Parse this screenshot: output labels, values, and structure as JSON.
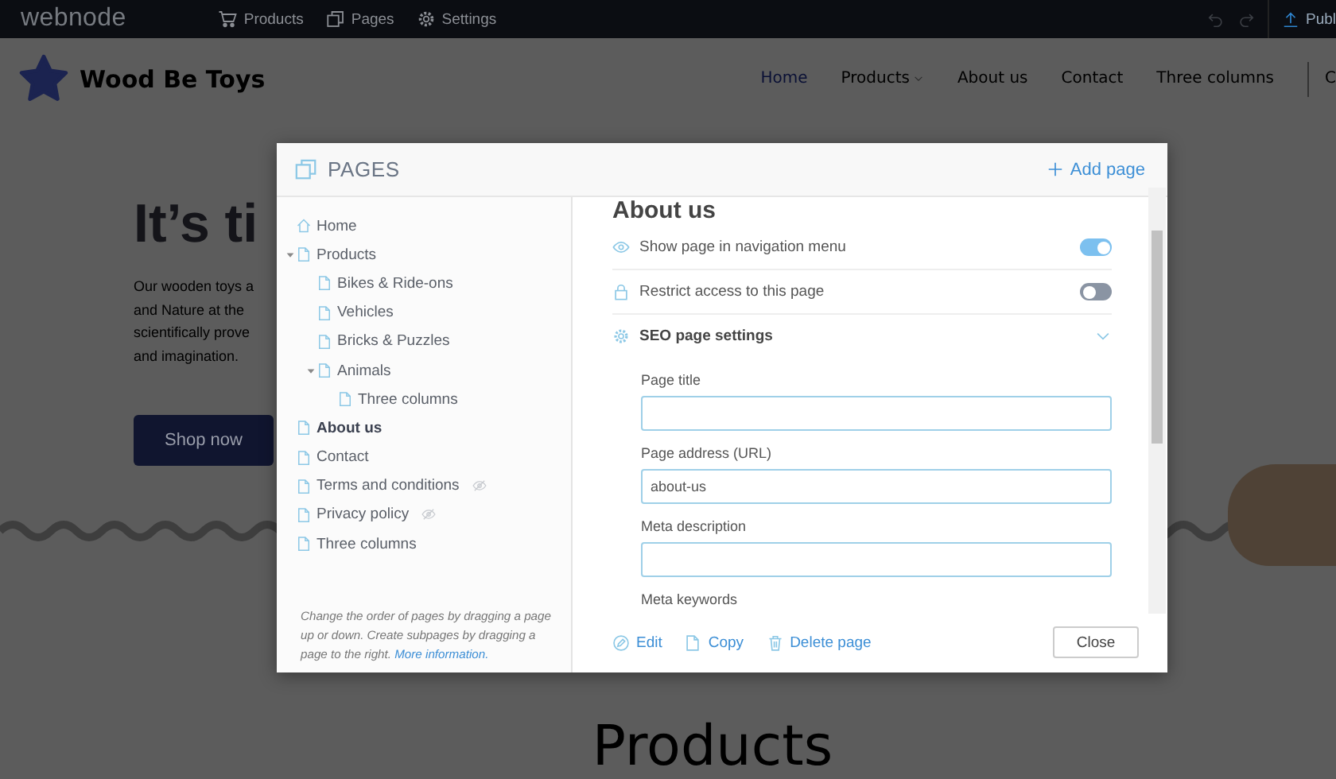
{
  "topbar": {
    "logo": "webnode",
    "menu": [
      {
        "label": "Products"
      },
      {
        "label": "Pages"
      },
      {
        "label": "Settings"
      }
    ],
    "publish": "Publ"
  },
  "site": {
    "brand": "Wood Be Toys",
    "nav": [
      {
        "label": "Home",
        "selected": true,
        "has_menu": false
      },
      {
        "label": "Products",
        "selected": false,
        "has_menu": true
      },
      {
        "label": "About us",
        "selected": false,
        "has_menu": false
      },
      {
        "label": "Contact",
        "selected": false,
        "has_menu": false
      },
      {
        "label": "Three columns",
        "selected": false,
        "has_menu": false
      }
    ],
    "nav_more": "C",
    "hero": {
      "heading": "It’s ti",
      "lines": [
        "Our wooden toys a",
        "and Nature at the",
        "scientifically prove",
        "and imagination."
      ],
      "button": "Shop now"
    },
    "section_heading": "Products"
  },
  "dialog": {
    "title": "PAGES",
    "add_button": "Add page",
    "tree": [
      {
        "label": "Home",
        "kind": "home",
        "selected": false,
        "hidden": false
      },
      {
        "label": "Products",
        "kind": "page",
        "selected": false,
        "hidden": false,
        "expanded": true,
        "children": [
          {
            "label": "Bikes & Ride-ons",
            "kind": "page",
            "selected": false,
            "hidden": false
          },
          {
            "label": "Vehicles",
            "kind": "page",
            "selected": false,
            "hidden": false
          },
          {
            "label": "Bricks & Puzzles",
            "kind": "page",
            "selected": false,
            "hidden": false
          },
          {
            "label": "Animals",
            "kind": "page",
            "selected": false,
            "hidden": false,
            "expanded": true,
            "children": [
              {
                "label": "Three columns",
                "kind": "page",
                "selected": false,
                "hidden": false
              }
            ]
          }
        ]
      },
      {
        "label": "About us",
        "kind": "page",
        "selected": true,
        "hidden": false
      },
      {
        "label": "Contact",
        "kind": "page",
        "selected": false,
        "hidden": false
      },
      {
        "label": "Terms and conditions",
        "kind": "page",
        "selected": false,
        "hidden": true
      },
      {
        "label": "Privacy policy",
        "kind": "page",
        "selected": false,
        "hidden": true
      },
      {
        "label": "Three columns",
        "kind": "page",
        "selected": false,
        "hidden": false
      }
    ],
    "hint": "Change the order of pages by dragging a page up or down. Create subpages by dragging a page to the right.",
    "hint_link": "More information.",
    "page_title": "About us",
    "settings": [
      {
        "kind": "toggle",
        "label": "Show page in navigation menu",
        "on": true
      },
      {
        "kind": "toggle",
        "label": "Restrict access to this page",
        "on": false
      },
      {
        "kind": "section",
        "label": "SEO page settings",
        "expanded": true
      }
    ],
    "fields": [
      {
        "label": "Page title"
      },
      {
        "label": "Page address (URL)",
        "value": "about-us"
      },
      {
        "label": "Meta description"
      },
      {
        "label": "Meta keywords"
      }
    ],
    "actions": [
      {
        "label": "Edit"
      },
      {
        "label": "Copy"
      },
      {
        "label": "Delete page"
      }
    ],
    "close": "Close"
  }
}
